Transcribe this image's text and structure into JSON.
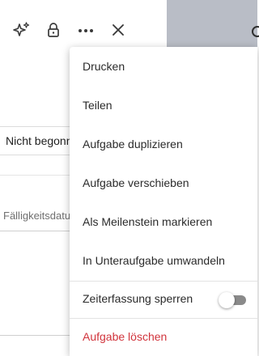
{
  "toolbar": {
    "icons": [
      "sparkle-icon",
      "lock-icon",
      "more-icon",
      "close-icon"
    ]
  },
  "right_panel": {
    "icon": "search-icon"
  },
  "task": {
    "status_value": "Nicht begonnen",
    "due_date_placeholder": "Fälligkeitsdatum"
  },
  "menu": {
    "items": [
      {
        "label": "Drucken"
      },
      {
        "label": "Teilen"
      },
      {
        "label": "Aufgabe duplizieren"
      },
      {
        "label": "Aufgabe verschieben"
      },
      {
        "label": "Als Meilenstein markieren"
      },
      {
        "label": "In Unteraufgabe umwandeln"
      }
    ],
    "time_tracking": {
      "label": "Zeiterfassung sperren",
      "enabled": false
    },
    "delete_label": "Aufgabe löschen"
  },
  "colors": {
    "danger": "#d1343c",
    "toggle_track": "#8a8a8a",
    "background_panel": "#cfd2d9"
  }
}
